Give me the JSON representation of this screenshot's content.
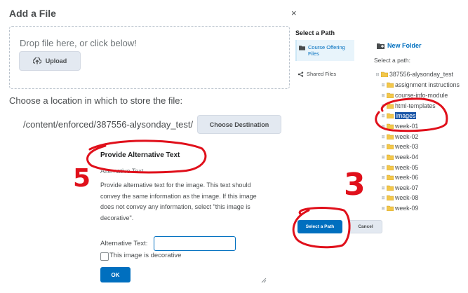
{
  "dialog": {
    "title": "Add a File",
    "close_symbol": "×",
    "dropzone_text": "Drop file here, or click below!",
    "upload_label": "Upload",
    "choose_location_label": "Choose a location in which to store the file:",
    "destination_path": "/content/enforced/387556-alysonday_test/",
    "choose_destination_label": "Choose Destination"
  },
  "alt_text": {
    "heading": "Provide Alternative Text",
    "subheading": "Alternative Text",
    "description": "Provide alternative text for the image. This text should convey the same information as the image. If this image does not convey any information, select \"this image is decorative\".",
    "field_label": "Alternative Text:",
    "field_value": "",
    "decorative_label": "This image is decorative",
    "decorative_checked": false,
    "ok_label": "OK"
  },
  "path_panel": {
    "title": "Select a Path",
    "sources": [
      {
        "label": "Course Offering Files",
        "icon": "folder-icon",
        "active": true
      },
      {
        "label": "Shared Files",
        "icon": "share-icon",
        "active": false
      }
    ],
    "new_folder_label": "New Folder",
    "select_path_label": "Select a path:",
    "tree": {
      "root": "387556-alysonday_test",
      "children": [
        "assignment instructions",
        "course-info-module",
        "html-templates",
        "images",
        "week-01",
        "week-02",
        "week-03",
        "week-04",
        "week-05",
        "week-06",
        "week-07",
        "week-08",
        "week-09"
      ],
      "selected": "images"
    },
    "select_path_button": "Select a Path",
    "cancel_button": "Cancel"
  },
  "annotations": {
    "numbers": [
      "5",
      "3"
    ],
    "color": "#e0101b"
  },
  "colors": {
    "primary_blue": "#006fbf",
    "selected_highlight": "#1a56a8",
    "folder_yellow": "#f3c74a",
    "annotation_red": "#e0101b"
  }
}
